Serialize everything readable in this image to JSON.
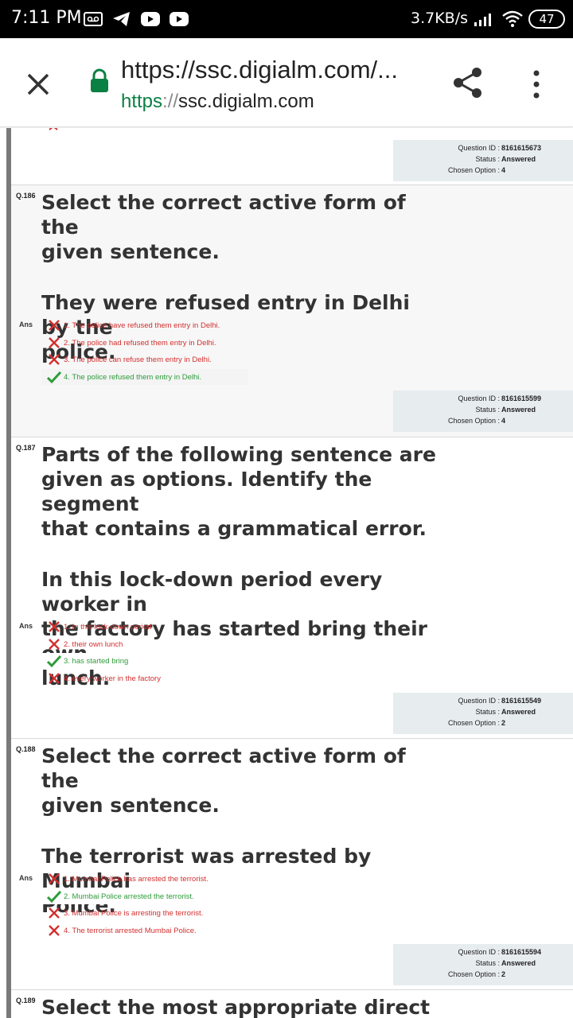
{
  "status_bar": {
    "time": "7:11 PM",
    "speed": "3.7KB/s",
    "battery": "47"
  },
  "browser": {
    "url_title": "https://ssc.digialm.com/...",
    "url_scheme": "https",
    "url_sep": "://",
    "url_host": "ssc.digialm.com"
  },
  "labels": {
    "question_id": "Question ID :",
    "status": "Status :",
    "chosen_option": "Chosen Option :",
    "ans": "Ans"
  },
  "prev_info": {
    "question_id": "8161615673",
    "status": "Answered",
    "chosen_option": "4"
  },
  "questions": [
    {
      "number": "Q.186",
      "text_line1": "Select the correct active form of the",
      "text_line2": "given sentence.",
      "text_line3": "They were refused entry in Delhi by the",
      "text_line4": "police.",
      "options": [
        {
          "text": "1. The police have refused them entry in Delhi.",
          "correct": false
        },
        {
          "text": "2. The police had refused them entry in Delhi.",
          "correct": false
        },
        {
          "text": "3. The police can refuse them entry in Delhi.",
          "correct": false
        },
        {
          "text": "4. The police refused them entry in Delhi.",
          "correct": true
        }
      ],
      "info": {
        "question_id": "8161615599",
        "status": "Answered",
        "chosen_option": "4"
      }
    },
    {
      "number": "Q.187",
      "text_line1": "Parts of the following sentence are",
      "text_line2": "given as options. Identify the segment",
      "text_line3": "that contains a grammatical error.",
      "text_line4": "In this lock-down period every worker in",
      "text_line5": "the factory has started bring their own",
      "text_line6": "lunch.",
      "options": [
        {
          "text": "1. In this lock-down period",
          "correct": false
        },
        {
          "text": "2. their own lunch",
          "correct": false
        },
        {
          "text": "3. has started bring",
          "correct": true
        },
        {
          "text": "4. every worker in the factory",
          "correct": false
        }
      ],
      "info": {
        "question_id": "8161615549",
        "status": "Answered",
        "chosen_option": "2"
      }
    },
    {
      "number": "Q.188",
      "text_line1": "Select the correct active form of the",
      "text_line2": "given sentence.",
      "text_line3": "The terrorist was arrested by Mumbai",
      "text_line4": "Police.",
      "options": [
        {
          "text": "1. Mumbai Police has arrested the terrorist.",
          "correct": false
        },
        {
          "text": "2. Mumbai Police arrested the terrorist.",
          "correct": true
        },
        {
          "text": "3. Mumbai Police is arresting the terrorist.",
          "correct": false
        },
        {
          "text": "4. The terrorist arrested Mumbai Police.",
          "correct": false
        }
      ],
      "info": {
        "question_id": "8161615594",
        "status": "Answered",
        "chosen_option": "2"
      }
    },
    {
      "number": "Q.189",
      "text_line1": "Select the most appropriate direct form"
    }
  ]
}
